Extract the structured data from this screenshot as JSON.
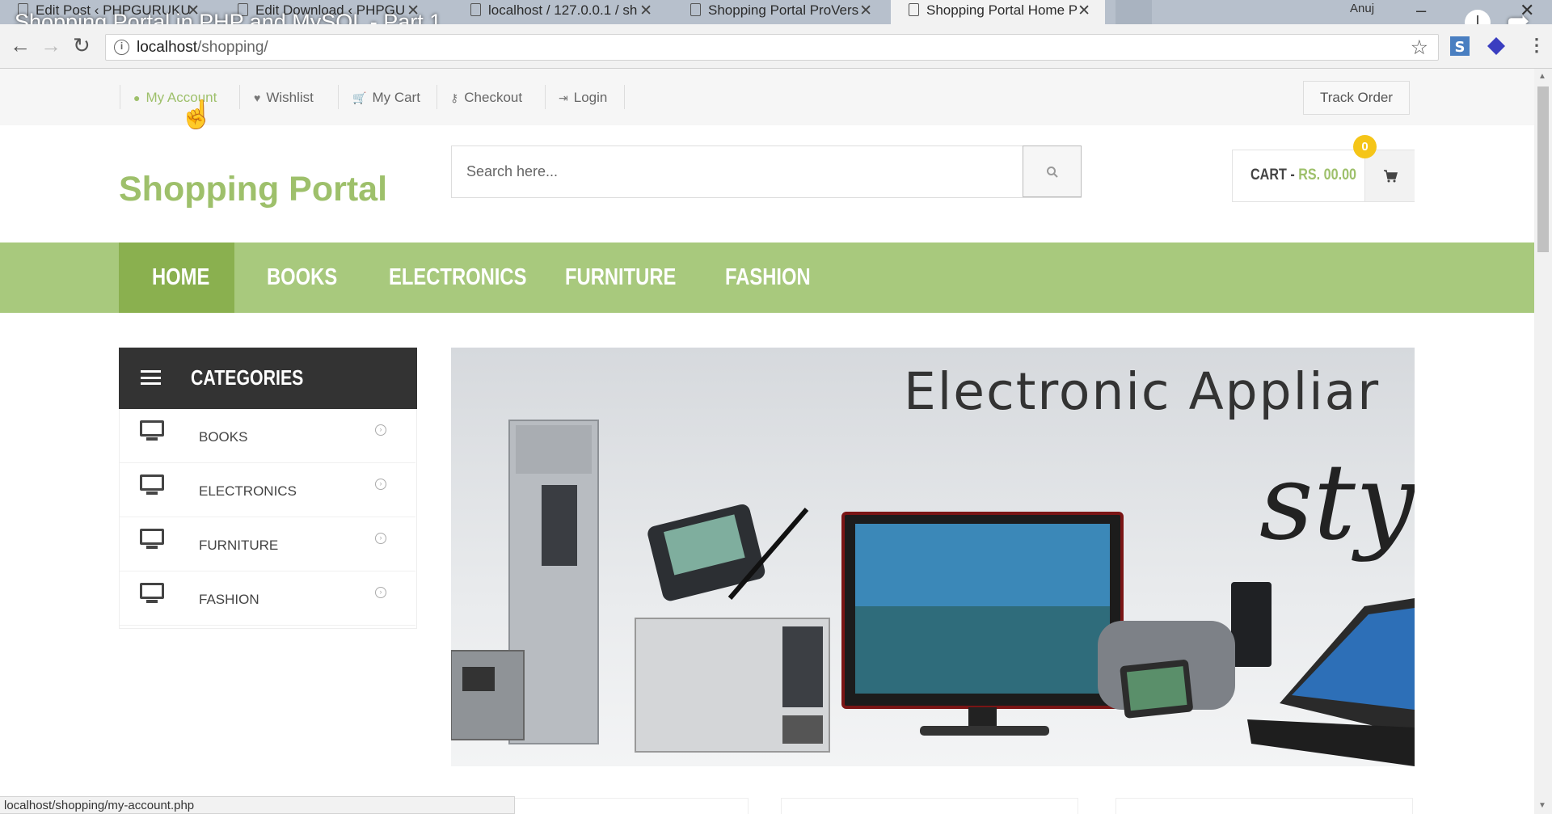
{
  "video": {
    "title": "Shopping Portal in PHP and MySQL - Part 1"
  },
  "browser": {
    "tabs": [
      {
        "label": "Edit Post ‹ PHPGURUKU"
      },
      {
        "label": "Edit Download ‹ PHPGU"
      },
      {
        "label": "localhost / 127.0.0.1 / sh"
      },
      {
        "label": "Shopping Portal ProVers"
      },
      {
        "label": "Shopping Portal Home P"
      }
    ],
    "user_name": "Anuj",
    "url_host": "localhost",
    "url_path": "/shopping/",
    "status_url": "localhost/shopping/my-account.php"
  },
  "topbar": {
    "links": [
      {
        "label": "My Account"
      },
      {
        "label": "Wishlist"
      },
      {
        "label": "My Cart"
      },
      {
        "label": "Checkout"
      },
      {
        "label": "Login"
      }
    ],
    "track_order": "Track Order"
  },
  "header": {
    "logo": "Shopping Portal",
    "search_placeholder": "Search here...",
    "cart_prefix": "CART - ",
    "cart_total": "RS. 00.00",
    "cart_count": "0"
  },
  "nav": {
    "items": [
      {
        "label": "HOME"
      },
      {
        "label": "BOOKS"
      },
      {
        "label": "ELECTRONICS"
      },
      {
        "label": "FURNITURE"
      },
      {
        "label": "FASHION"
      }
    ]
  },
  "categories": {
    "title": "CATEGORIES",
    "items": [
      {
        "label": "BOOKS"
      },
      {
        "label": "ELECTRONICS"
      },
      {
        "label": "FURNITURE"
      },
      {
        "label": "FASHION"
      }
    ]
  },
  "banner": {
    "title": "Electronic Appliar",
    "script": "sty"
  },
  "colors": {
    "accent": "#9ec06b",
    "nav_bg": "#a8c97d",
    "nav_active": "#8ab04f",
    "category_header": "#333333",
    "badge": "#f5c518"
  }
}
